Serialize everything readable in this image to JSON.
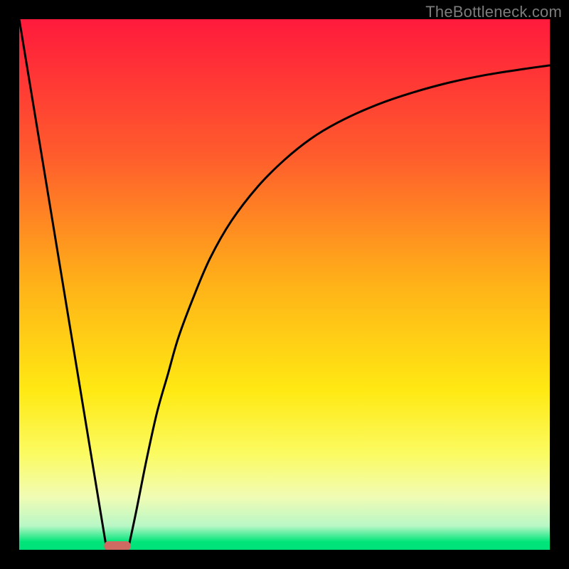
{
  "watermark": "TheBottleneck.com",
  "chart_data": {
    "type": "line",
    "title": "",
    "xlabel": "",
    "ylabel": "",
    "xlim": [
      0,
      100
    ],
    "ylim": [
      0,
      100
    ],
    "grid": false,
    "legend": false,
    "background": {
      "type": "vertical-gradient",
      "stops": [
        {
          "pos": 0.0,
          "color": "#ff1a3c"
        },
        {
          "pos": 0.25,
          "color": "#ff5a2d"
        },
        {
          "pos": 0.5,
          "color": "#ffb218"
        },
        {
          "pos": 0.7,
          "color": "#ffe913"
        },
        {
          "pos": 0.82,
          "color": "#fbfb62"
        },
        {
          "pos": 0.9,
          "color": "#f1fcb4"
        },
        {
          "pos": 0.955,
          "color": "#b8f7c6"
        },
        {
          "pos": 0.985,
          "color": "#00e57a"
        },
        {
          "pos": 1.0,
          "color": "#00e07a"
        }
      ]
    },
    "series": [
      {
        "name": "left-line",
        "x": [
          0,
          16.5
        ],
        "y": [
          100,
          0
        ],
        "note": "straight segment from top-left to valley"
      },
      {
        "name": "right-curve",
        "x": [
          20.5,
          22,
          24,
          26,
          28,
          30,
          33,
          36,
          40,
          45,
          50,
          55,
          60,
          66,
          72,
          80,
          88,
          95,
          100
        ],
        "y": [
          0,
          7,
          17,
          26,
          33,
          40,
          48,
          55,
          62,
          68.5,
          73.5,
          77.5,
          80.5,
          83.3,
          85.5,
          87.8,
          89.5,
          90.6,
          91.3
        ],
        "note": "concave-down saturating curve from valley toward top-right"
      }
    ],
    "marker": {
      "name": "valley-marker",
      "shape": "rounded-rect",
      "x_center": 18.5,
      "x_width": 5.0,
      "y": 0,
      "color": "#cf6a62"
    }
  }
}
